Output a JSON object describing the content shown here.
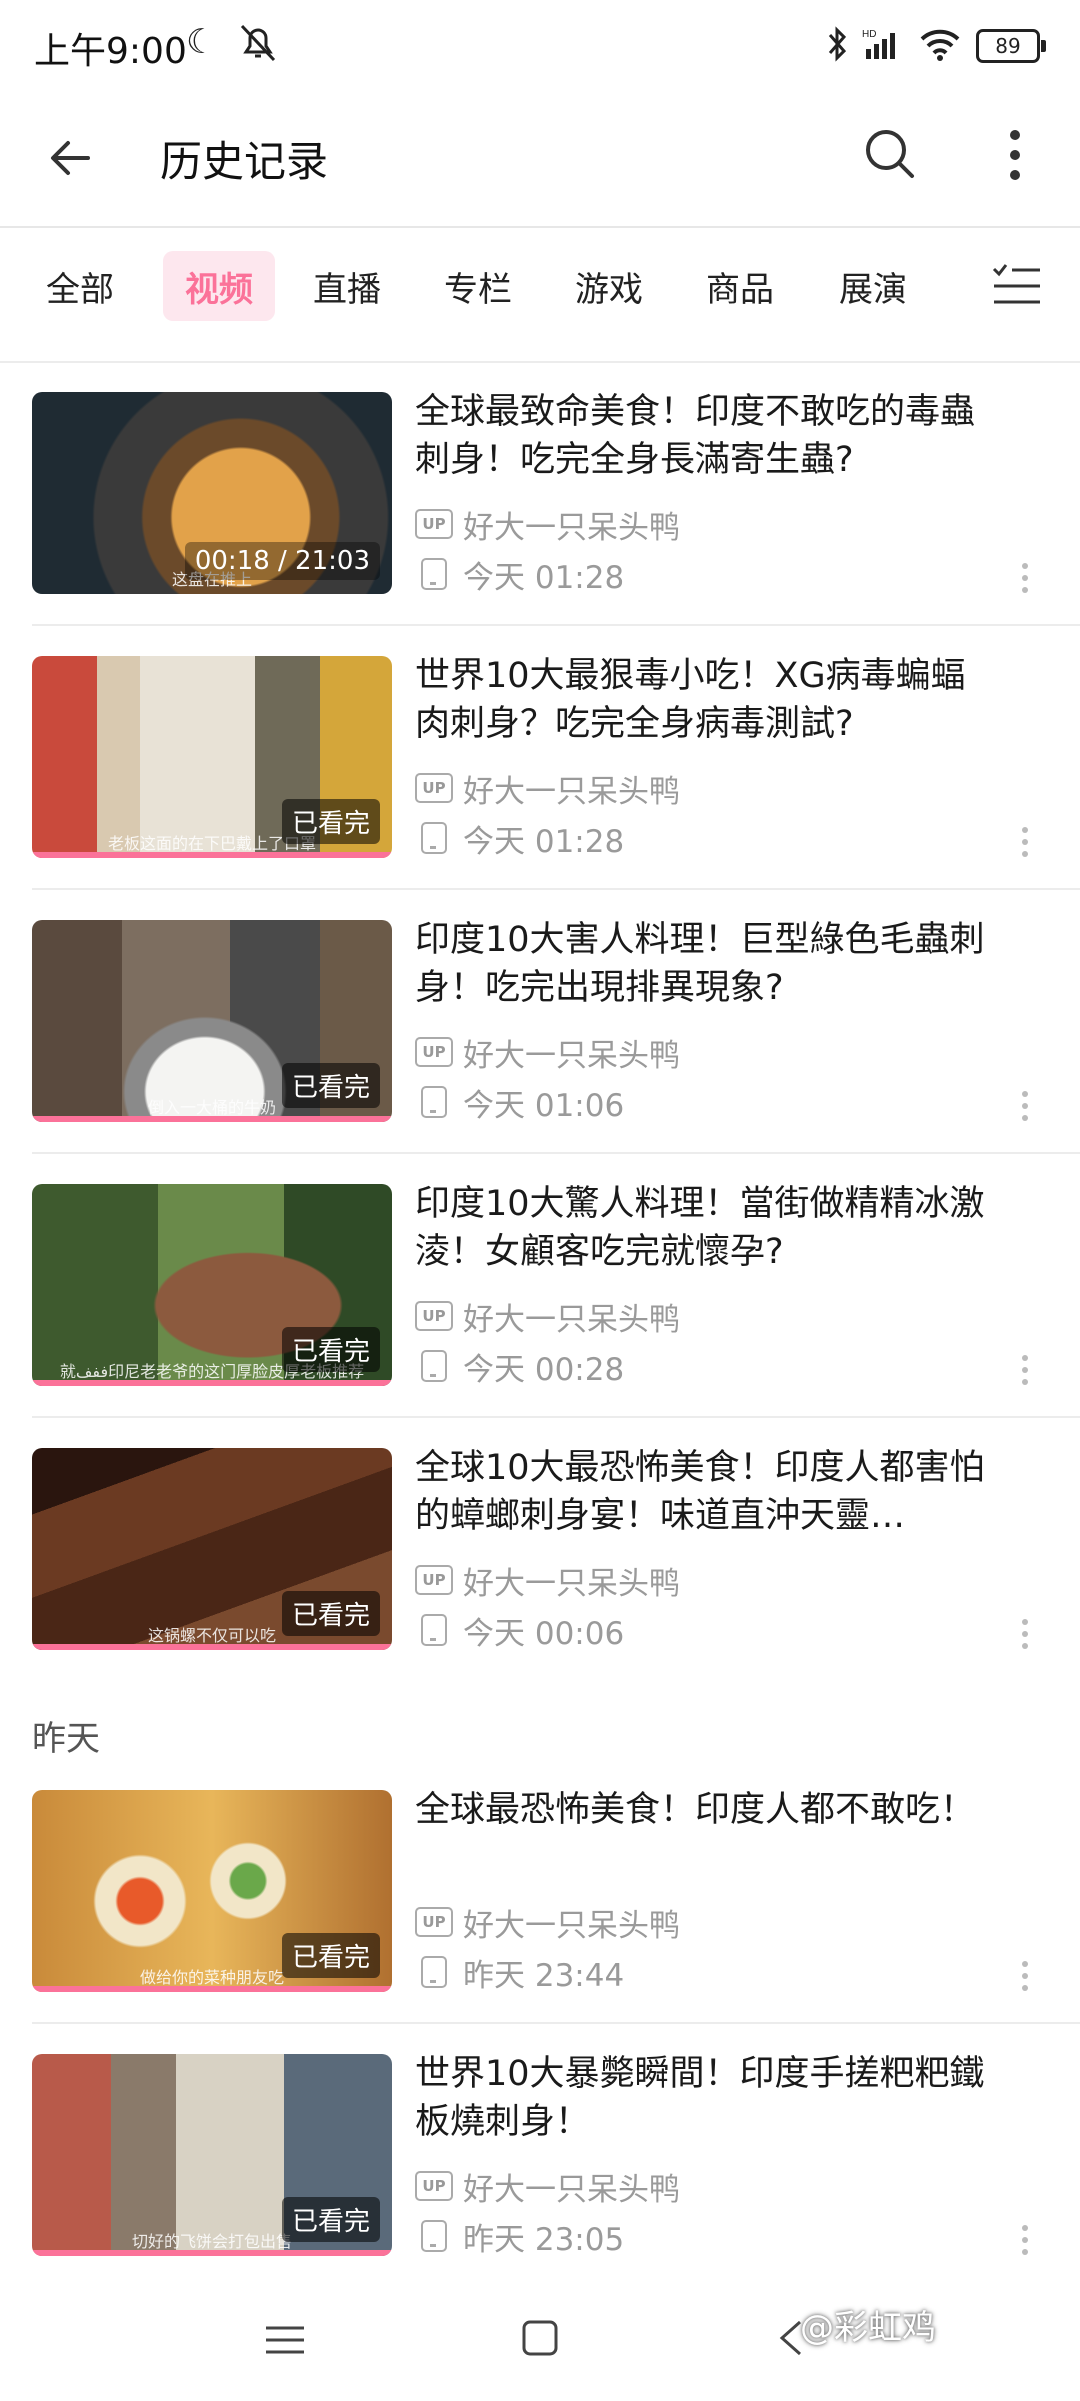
{
  "status_bar": {
    "time": "上午9:00",
    "moon_icon": "moon-icon",
    "mute_icon": "bell-off-icon",
    "battery": "89"
  },
  "header": {
    "title": "历史记录",
    "back_icon": "back-arrow-icon",
    "search_icon": "search-icon",
    "more_icon": "more-vertical-icon"
  },
  "tabs": [
    {
      "label": "全部"
    },
    {
      "label": "视频",
      "active": true
    },
    {
      "label": "直播"
    },
    {
      "label": "专栏"
    },
    {
      "label": "游戏"
    },
    {
      "label": "商品"
    },
    {
      "label": "展演"
    }
  ],
  "filter_icon": "filter-list-icon",
  "today_items": [
    {
      "title": "全球最致命美食！印度不敢吃的毒蟲刺身！吃完全身長滿寄生蟲?",
      "uploader": "好大一只呆头鸭",
      "time": "今天 01:28",
      "badge": "00:18 / 21:03",
      "caption": "这盘在推上"
    },
    {
      "title": "世界10大最狠毒小吃！XG病毒蝙蝠肉刺身？吃完全身病毒測試?",
      "uploader": "好大一只呆头鸭",
      "time": "今天 01:28",
      "badge": "已看完",
      "caption": "老板这面的在下巴戴上了口罩"
    },
    {
      "title": "印度10大害人料理！巨型綠色毛蟲刺身！吃完出現排異現象?",
      "uploader": "好大一只呆头鸭",
      "time": "今天 01:06",
      "badge": "已看完",
      "caption": "倒入一大桶的牛奶"
    },
    {
      "title": "印度10大驚人料理！當街做精精冰激淩！女顧客吃完就懷孕?",
      "uploader": "好大一只呆头鸭",
      "time": "今天 00:28",
      "badge": "已看完",
      "caption": "就ففف印尼老老爷的这门厚脸皮厚老板推荐"
    },
    {
      "title": "全球10大最恐怖美食！印度人都害怕的蟑螂刺身宴！味道直沖天靈…",
      "uploader": "好大一只呆头鸭",
      "time": "今天 00:06",
      "badge": "已看完",
      "caption": "这锅螺不仅可以吃"
    }
  ],
  "section_yesterday": "昨天",
  "yesterday_items": [
    {
      "title": "全球最恐怖美食！印度人都不敢吃！",
      "uploader": "好大一只呆头鸭",
      "time": "昨天 23:44",
      "badge": "已看完",
      "caption": "做给你的菜种朋友吃"
    },
    {
      "title": "世界10大暴斃瞬間！印度手搓粑粑鐵板燒刺身！",
      "uploader": "好大一只呆头鸭",
      "time": "昨天 23:05",
      "badge": "已看完",
      "caption": "切好的飞饼会打包出售"
    }
  ],
  "up_label": "UP",
  "nav_bar": {
    "menu_icon": "menu-icon",
    "home_icon": "home-square-icon",
    "back_icon": "nav-back-icon"
  },
  "watermark": "@彩虹鸡",
  "colors": {
    "accent": "#fb7299",
    "tab_active_bg": "#fde7ee",
    "meta_text": "#9a9a9a"
  }
}
